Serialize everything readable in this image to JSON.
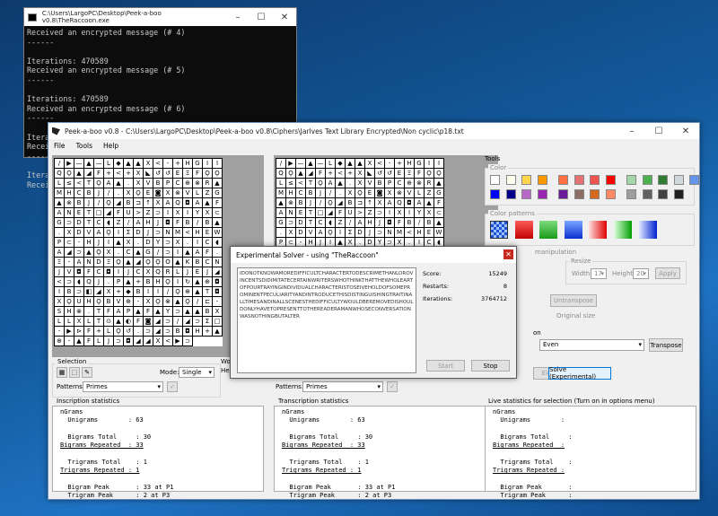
{
  "console": {
    "title": "C:\\Users\\LargoPC\\Desktop\\Peek-a-boo v0.8\\TheRaccoon.exe",
    "lines": [
      "Received an encrypted message (# 4)",
      "------",
      "",
      "Iterations: 470589",
      "Received an encrypted message (# 5)",
      "------",
      "",
      "Iterations: 470589",
      "Received an encrypted message (# 6)",
      "------",
      "",
      "Iterations: 470589",
      "Recei",
      "------",
      "",
      "Itera",
      "Recei"
    ]
  },
  "main": {
    "title": "Peek-a-boo v0.8 - C:\\Users\\LargoPC\\Desktop\\Peek-a-boo v0.8\\Ciphers\\Jarlves Text Library Encrypted\\Non cyclic\\p18.txt",
    "menu": [
      "File",
      "Tools",
      "Help"
    ],
    "left_grid": [
      "/ ▶ — ▲ — L ◆ ▲ ▲ X < - + H G",
      "I I Q Ϙ ▲ ◢ F + < + X ◣ ↺ ↺ E",
      "Ξ F Ϙ Ϙ L ≤ < T Ϙ A ▲ . X V B",
      "Ρ C ⊕ ⊗ R ▲ M H C B J / . X Ϙ E",
      "◙ X ⊗ V L Z G ▲ ⊗ B J / Ϙ ◢ B",
      "⊐ ↑ X A Q ◘ A ▲ F A N E T □ ◢ F",
      "U > Z ⊃ I X I Y X ⊂ G ⊃ D T C ◖",
      "Ζ / A H J ◘ F B / B ▲ . X D V A Ϙ",
      "I Σ D J ⊃ N M < H E W P ⊂ - H J",
      "I ▲ X . D Y ⊃ X . I C ◖ A ◢ ⊃ ▲ Ϙ",
      "X . C ▲ G / ⊃ I ▲ A F . Ξ - A N D",
      "Ξ Ϙ ▲ ◢ Ϙ Ϙ O ▲ K B C N J V ◘ F",
      "C ◘ I J C X Q R L J E J ◢ < ⊃ ◖ Q",
      "J . P ▲ + B H Ϙ I ↻ ▲ ⊕ ◘ I B ⊃",
      "◧ ◢ X + ◆ B I I / Ϙ ⊕ ▲ T ◘ X Ϙ",
      "U H Ϙ B V ⊕ - X Ϙ ⊗ ▲ Ϙ / ⊏ - S",
      "H ⊗ . T F A P ▲ F ▲ Y ⊃ ▲ ▲ B X",
      "L L X L T ⊙ ▲ ◐ F ◙ ◢ ⊃ / ◢ ⊃ Σ",
      "□ - ▶ ⊳ F + L Ϙ ↺ . ⊃ ◢ ⊃ B ◘ H",
      "+ ▲ ⊕ - ▲ F L J ⊃ ◘ ◢ ◢ X < ▶ ⊃"
    ],
    "selection_label": "Selection",
    "mode_label": "Mode:",
    "mode_value": "Single",
    "patterns_label": "Patterns:",
    "patterns_value": "Primes",
    "we_label": "Wo",
    "he_label": "Hei",
    "inscription": {
      "label": "Inscription statistics",
      "ngrams": "nGrams",
      "unigrams": "Unigrams        : 63",
      "bigrams_total": "Bigrams Total     : 30",
      "bigrams_rep": "Bigrams Repeated  : 33",
      "trigrams_total": "Trigrams Total    : 1",
      "trigrams_rep": "Trigrams Repeated : 1",
      "bigram_peak": "Bigram Peak       : 33 at P1",
      "trigram_peak": "Trigram Peak      : 2 at P3"
    },
    "transcription": {
      "label": "Transcription statistics",
      "ngrams": "nGrams",
      "unigrams": "Unigrams        : 63",
      "bigrams_total": "Bigrams Total     : 30",
      "bigrams_rep": "Bigrams Repeated  : 33",
      "trigrams_total": "Trigrams Total    : 1",
      "trigrams_rep": "Trigrams Repeated : 1",
      "bigram_peak": "Bigram Peak       : 33 at P1",
      "trigram_peak": "Trigram Peak      : 2 at P3"
    },
    "live": {
      "label": "Live statistics for selection (Turn on in options menu)",
      "ngrams": "nGrams",
      "unigrams": "Unigrams        :",
      "bigrams_total": "Bigrams Total     :",
      "bigrams_rep": "Bigrams Repeated  :",
      "trigrams_total": "Trigrams Total    :",
      "trigrams_rep": "Trigrams Repeated :",
      "bigram_peak": "Bigram Peak       :",
      "trigram_peak": "Trigram Peak      :"
    },
    "tools": {
      "label": "Tools",
      "color_label": "Color",
      "color_patterns_label": "Color patterns",
      "manipulation_label": "manipulation",
      "resize_label": "Resize",
      "width_label": "Width:",
      "width_value": "17",
      "height_label": "Height:",
      "height_value": "20",
      "apply": "Apply",
      "untranspose_small": "Untranspose",
      "original_size": "Original size",
      "on_label": "on",
      "dropdown_value": "Even",
      "transpose": "Transpose",
      "untranspose": "Untranspose",
      "solve": "Solve (Experimental)",
      "e_small": "Ele",
      "colors": [
        "#ffffff",
        "#fffff0",
        "#ffd54f",
        "#ff9800",
        "#ff7043",
        "#e57373",
        "#ef5350",
        "#ff0000",
        "#a5d6a7",
        "#4caf50",
        "#2e7d32",
        "#cfd8dc",
        "#6495ed",
        "#0000ff",
        "#00008b",
        "#ba68c8",
        "#9c27b0",
        "#6a1b9a",
        "#8d6e63",
        "#d2691e",
        "#ff8a65",
        "#9e9e9e",
        "#616161",
        "#424242",
        "#212121"
      ]
    },
    "patterns2_label": "Patterns:",
    "patterns2_value": "Primes"
  },
  "dialog": {
    "title": "Experimental Solver - using \"TheRaccoon\"",
    "text": "IDONOTKNOWAMOREDIFFICULTCHARACTERTODESCRIMETHANLOROVINCENTSDIDIMITATECERTAINWRITERSWHOTHINKTHATTHEWHOLEARTOFPOURTRAYINGINDIVIDUALCHARACTERISTOSEIVEHOLDOFSOMEPROMINENTPECULIARITYANDINTRODUCETHISDISTINGUISHINGTRAITINALLTIMESANDINALLSCENESTHEDIFFICULTYWOULDBEREMOVEDISHOULDONLYHAVETOPRESENTTOTHEREADERAMANWHOSECONVERSATIONWASNOTHINGBUTALTER",
    "score_label": "Score:",
    "score": "15249",
    "restarts_label": "Restarts:",
    "restarts": "8",
    "iterations_label": "Iterations:",
    "iterations": "3764712",
    "start": "Start",
    "stop": "Stop"
  }
}
